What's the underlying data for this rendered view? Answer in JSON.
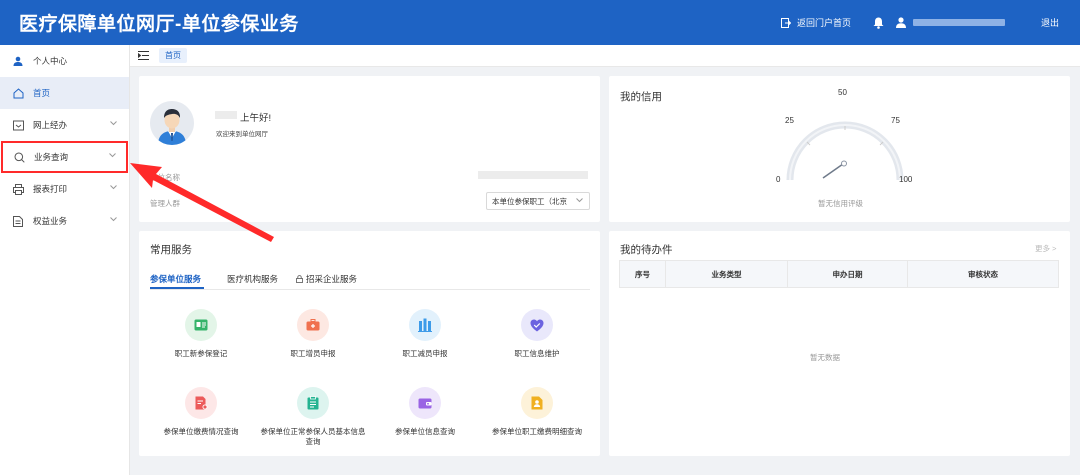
{
  "header": {
    "title": "医疗保障单位网厅-单位参保业务",
    "portal_link": "返回门户首页",
    "logout": "退出"
  },
  "sidebar": {
    "items": [
      {
        "label": "个人中心",
        "icon": "person-icon"
      },
      {
        "label": "首页",
        "icon": "home-icon"
      },
      {
        "label": "网上经办",
        "icon": "inbox-icon"
      },
      {
        "label": "业务查询",
        "icon": "search-icon"
      },
      {
        "label": "报表打印",
        "icon": "printer-icon"
      },
      {
        "label": "权益业务",
        "icon": "document-icon"
      }
    ]
  },
  "breadcrumb": {
    "tab": "首页"
  },
  "profile": {
    "greeting": "上午好!",
    "welcome": "欢迎来到单位网厅",
    "unit_label": "单位名称",
    "crowd_label": "管理人群",
    "crowd_value": "本单位参保职工（北京"
  },
  "credit": {
    "title": "我的信用",
    "gauge_labels": [
      "0",
      "25",
      "50",
      "75",
      "100"
    ],
    "note": "暂无信用评级"
  },
  "services": {
    "title": "常用服务",
    "tabs": [
      "参保单位服务",
      "医疗机构服务",
      "招采企业服务"
    ],
    "items": [
      {
        "label": "职工新参保登记",
        "color": "#e3f5e8",
        "icon_color": "#35b36a"
      },
      {
        "label": "职工增员申报",
        "color": "#fde8e2",
        "icon_color": "#f0714f"
      },
      {
        "label": "职工减员申报",
        "color": "#e2f1fc",
        "icon_color": "#3d9be9"
      },
      {
        "label": "职工信息维护",
        "color": "#e9e8fb",
        "icon_color": "#6c63e0"
      },
      {
        "label": "参保单位缴费情况查询",
        "color": "#fde7e7",
        "icon_color": "#ec5a5a"
      },
      {
        "label": "参保单位正常参保人员基本信息查询",
        "color": "#ddf4ef",
        "icon_color": "#23b391"
      },
      {
        "label": "参保单位信息查询",
        "color": "#eee6fb",
        "icon_color": "#9a64e4"
      },
      {
        "label": "参保单位职工缴费明细查询",
        "color": "#fdf2d9",
        "icon_color": "#f0b020"
      }
    ]
  },
  "todo": {
    "title": "我的待办件",
    "more": "更多 >",
    "columns": [
      "序号",
      "业务类型",
      "申办日期",
      "审核状态"
    ],
    "empty": "暂无数据"
  },
  "colors": {
    "brand": "#1e63c4",
    "highlight": "#ff2a2a",
    "page_bg": "#f0f2f5"
  }
}
